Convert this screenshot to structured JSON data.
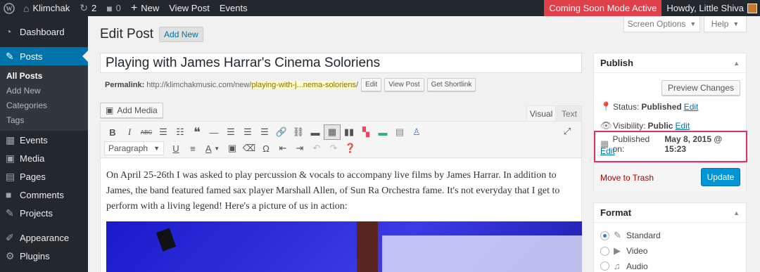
{
  "adminbar": {
    "site_name": "Klimchak",
    "updates_count": "2",
    "comments_count": "0",
    "new_label": "New",
    "view_post": "View Post",
    "events": "Events",
    "coming_soon": "Coming Soon Mode Active",
    "howdy": "Howdy, Little Shiva"
  },
  "sidebar": {
    "items": [
      {
        "label": "Dashboard",
        "icon": "dashboard-icon"
      },
      {
        "label": "Posts",
        "icon": "pin-icon"
      },
      {
        "label": "Events",
        "icon": "calendar-icon"
      },
      {
        "label": "Media",
        "icon": "media-icon"
      },
      {
        "label": "Pages",
        "icon": "pages-icon"
      },
      {
        "label": "Comments",
        "icon": "comment-icon"
      },
      {
        "label": "Projects",
        "icon": "pin-icon"
      },
      {
        "label": "Appearance",
        "icon": "brush-icon"
      },
      {
        "label": "Plugins",
        "icon": "plugin-icon"
      }
    ],
    "submenu": [
      "All Posts",
      "Add New",
      "Categories",
      "Tags"
    ]
  },
  "screen_options": "Screen Options",
  "help": "Help",
  "heading": {
    "title": "Edit Post",
    "add_new": "Add New"
  },
  "post": {
    "title": "Playing with James Harrar's Cinema Soloriens",
    "permalink_label": "Permalink:",
    "permalink_base": "http://klimchakmusic.com/new/",
    "permalink_slug": "playing-with-j...nema-soloriens",
    "permalink_tail": "/",
    "edit_btn": "Edit",
    "view_post_btn": "View Post",
    "shortlink_btn": "Get Shortlink"
  },
  "editor": {
    "add_media": "Add Media",
    "tab_visual": "Visual",
    "tab_text": "Text",
    "format_select": "Paragraph",
    "content": "On April 25-26th I was asked to play percussion & vocals to accompany live films by James Harrar. In addition to James, the band featured famed sax player Marshall Allen, of Sun Ra Orchestra fame. It's not everyday that I get to perform with a living legend! Here's a picture of us in action:"
  },
  "publish": {
    "title": "Publish",
    "preview": "Preview Changes",
    "status_label": "Status:",
    "status_value": "Published",
    "visibility_label": "Visibility:",
    "visibility_value": "Public",
    "edit": "Edit",
    "published_on_label": "Published on:",
    "published_on_value": "May 8, 2015 @ 15:23",
    "trash": "Move to Trash",
    "update": "Update"
  },
  "format": {
    "title": "Format",
    "options": [
      "Standard",
      "Video",
      "Audio"
    ],
    "selected": "Standard"
  },
  "colors": {
    "adminbar_bg": "#23282d",
    "accent": "#0073aa",
    "coming_soon_bg": "#e0404a",
    "highlight_border": "#d9346a"
  }
}
